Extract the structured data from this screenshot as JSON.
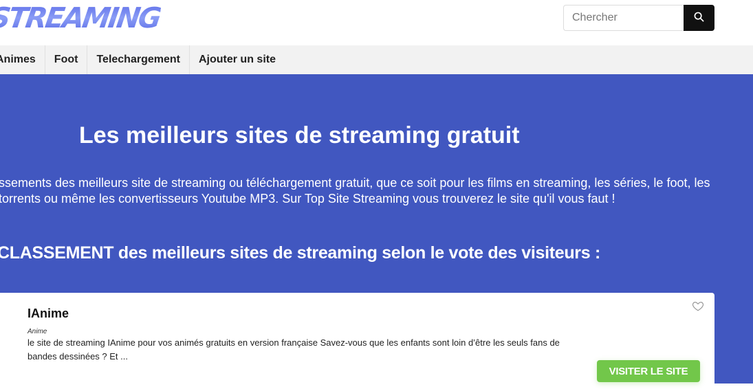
{
  "header": {
    "logo_text": "STREAMING",
    "search": {
      "placeholder": "Chercher",
      "value": "",
      "button_icon": "search-icon"
    }
  },
  "nav": {
    "items": [
      {
        "label": "Animes"
      },
      {
        "label": "Foot"
      },
      {
        "label": "Telechargement"
      },
      {
        "label": "Ajouter un site"
      }
    ]
  },
  "hero": {
    "title": "Les meilleurs sites de streaming gratuit",
    "intro": "ssements des meilleurs site de streaming ou téléchargement gratuit, que ce soit pour les films en streaming, les séries, le foot, les torrents ou même les convertisseurs Youtube MP3. Sur Top Site Streaming vous trouverez le site qu'il vous faut !",
    "ranking_heading": "CLASSEMENT des meilleurs sites de streaming selon le vote des visiteurs :"
  },
  "cards": [
    {
      "title": "IAnime",
      "category": "Anime",
      "description": "le site de streaming IAnime pour vos animés gratuits en version française Savez-vous que les enfants sont loin d’être les seuls fans de bandes dessinées ? Et ...",
      "favorite_icon": "heart-icon",
      "visit_label": "VISITER LE SITE"
    }
  ],
  "colors": {
    "brand_blue": "#4157c0",
    "visit_green": "#72c74a",
    "search_button": "#111111",
    "nav_bg": "#f2f2f2"
  }
}
